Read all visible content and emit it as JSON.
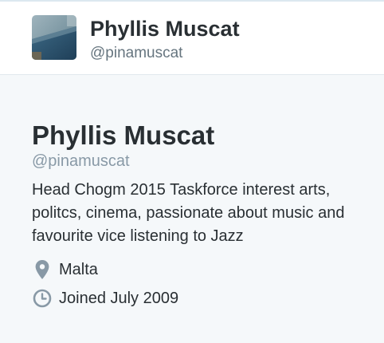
{
  "header": {
    "name": "Phyllis Muscat",
    "handle": "@pinamuscat"
  },
  "profile": {
    "name": "Phyllis Muscat",
    "handle": "@pinamuscat",
    "bio": "Head Chogm 2015 Taskforce interest arts, politcs, cinema, passionate about music and favourite vice listening to Jazz",
    "location": "Malta",
    "joined": "Joined July 2009"
  },
  "icons": {
    "location": "map-pin-icon",
    "joined": "clock-icon"
  },
  "colors": {
    "name_text": "#292f33",
    "handle_text": "#8899a6",
    "icon": "#8899a6",
    "background": "#f5f8fa",
    "header_background": "#ffffff"
  }
}
